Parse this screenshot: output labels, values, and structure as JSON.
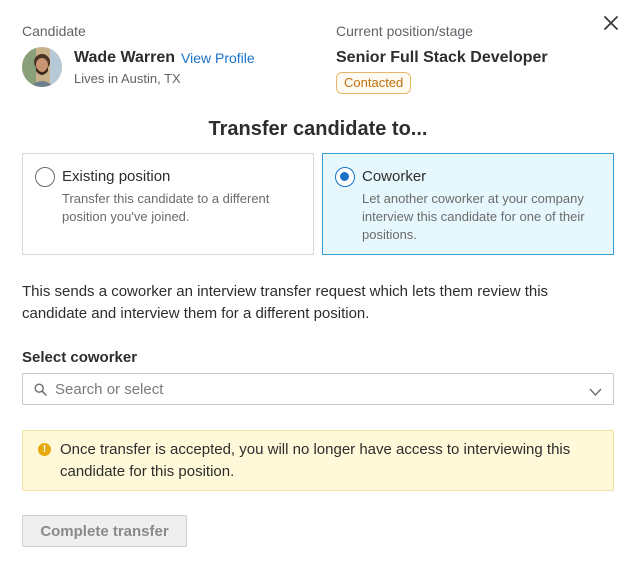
{
  "header": {
    "candidate_label": "Candidate",
    "candidate_name": "Wade Warren",
    "view_profile": "View Profile",
    "location": "Lives in Austin, TX",
    "position_label": "Current position/stage",
    "position_title": "Senior Full Stack Developer",
    "stage_badge": "Contacted"
  },
  "heading": "Transfer candidate to...",
  "options": [
    {
      "title": "Existing position",
      "description": "Transfer this candidate to a different position you've joined.",
      "selected": false
    },
    {
      "title": "Coworker",
      "description": "Let another coworker at your company interview this candidate for one of their positions.",
      "selected": true
    }
  ],
  "info_text": "This sends a coworker an interview transfer request which lets them review this candidate and interview them for a different position.",
  "select": {
    "label": "Select coworker",
    "placeholder": "Search or select",
    "value": ""
  },
  "warning": {
    "text": "Once transfer is accepted, you will no longer have access to interviewing this candidate for this position."
  },
  "button": {
    "label": "Complete transfer",
    "disabled": true
  },
  "colors": {
    "accent": "#1a73c8",
    "selected_bg": "#e6f8fd",
    "badge_border": "#e9b76a",
    "badge_text": "#c0710f",
    "warning_bg": "#fff8d9",
    "warning_icon": "#e8a90f"
  },
  "icons": {
    "close": "close-icon",
    "search": "search-icon",
    "chevron": "chevron-down-icon",
    "warning": "warning-icon"
  }
}
